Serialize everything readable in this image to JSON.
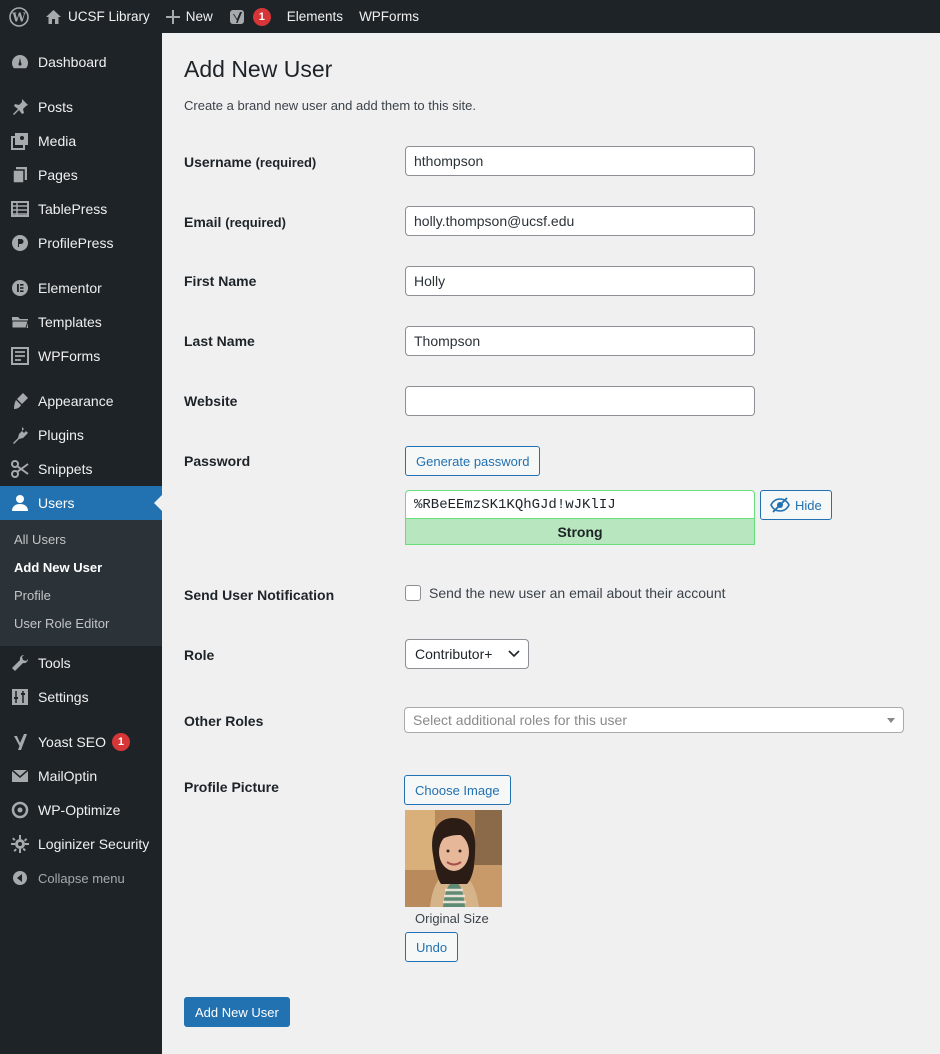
{
  "adminbar": {
    "site_name": "UCSF Library",
    "new_label": "New",
    "yoast_count": "1",
    "elements_label": "Elements",
    "wpforms_label": "WPForms"
  },
  "sidebar": {
    "dashboard": "Dashboard",
    "posts": "Posts",
    "media": "Media",
    "pages": "Pages",
    "tablepress": "TablePress",
    "profilepress": "ProfilePress",
    "elementor": "Elementor",
    "templates": "Templates",
    "wpforms": "WPForms",
    "appearance": "Appearance",
    "plugins": "Plugins",
    "snippets": "Snippets",
    "users": "Users",
    "users_sub": {
      "all_users": "All Users",
      "add_new_user": "Add New User",
      "profile": "Profile",
      "user_role_editor": "User Role Editor"
    },
    "tools": "Tools",
    "settings": "Settings",
    "yoast": "Yoast SEO",
    "yoast_count": "1",
    "mailoptin": "MailOptin",
    "wp_optimize": "WP-Optimize",
    "loginizer": "Loginizer Security",
    "collapse": "Collapse menu"
  },
  "page": {
    "title": "Add New User",
    "intro": "Create a brand new user and add them to this site."
  },
  "form": {
    "username": {
      "label": "Username",
      "req": "(required)",
      "value": "hthompson"
    },
    "email": {
      "label": "Email",
      "req": "(required)",
      "value": "holly.thompson@ucsf.edu"
    },
    "first_name": {
      "label": "First Name",
      "value": "Holly"
    },
    "last_name": {
      "label": "Last Name",
      "value": "Thompson"
    },
    "website": {
      "label": "Website",
      "value": ""
    },
    "password": {
      "label": "Password",
      "generate_label": "Generate password",
      "value": "%RBeEEmzSK1KQhGJd!wJKlIJ",
      "strength": "Strong",
      "hide_label": "Hide"
    },
    "notification": {
      "label": "Send User Notification",
      "checkbox_label": "Send the new user an email about their account",
      "checked": false
    },
    "role": {
      "label": "Role",
      "selected": "Contributor+"
    },
    "other_roles": {
      "label": "Other Roles",
      "placeholder": "Select additional roles for this user"
    },
    "profile_picture": {
      "label": "Profile Picture",
      "choose_label": "Choose Image",
      "caption": "Original Size",
      "undo_label": "Undo"
    },
    "submit_label": "Add New User"
  },
  "colors": {
    "accent": "#2271b1",
    "sidebar_bg": "#1d2327",
    "strength_bg": "#b8e6bf",
    "badge": "#d63638"
  }
}
